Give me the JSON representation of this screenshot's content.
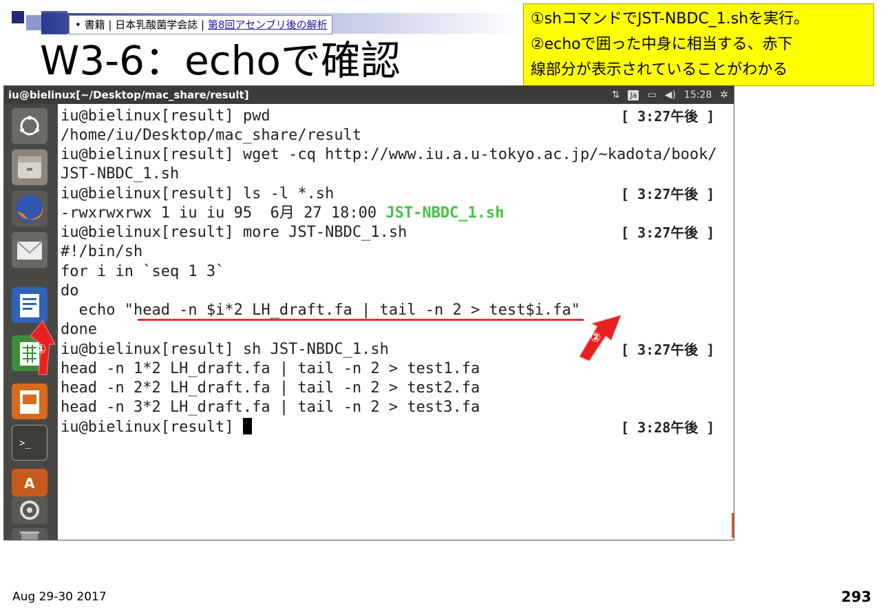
{
  "slide": {
    "reference": {
      "bullet": "•",
      "prefix": "書籍 | 日本乳酸菌学会誌 | ",
      "link": "第8回アセンブリ後の解析"
    },
    "title": "W3-6：echoで確認",
    "note_lines": [
      "①shコマンドでJST-NBDC_1.shを実行。",
      "②echoで囲った中身に相当する、赤下",
      "線部分が表示されていることがわかる"
    ],
    "footer_date": "Aug 29-30 2017",
    "page_number": "293"
  },
  "window": {
    "title": "iu@bielinux[~/Desktop/mac_share/result]",
    "ime": "Ja",
    "clock": "15:28",
    "indicator_icons": [
      "network-icon",
      "keyboard-icon",
      "battery-icon",
      "volume-icon",
      "settings-gear-icon"
    ]
  },
  "launcher": {
    "items": [
      "ubuntu-dash-icon",
      "files-icon",
      "firefox-icon",
      "mail-icon",
      "writer-icon",
      "calc-icon",
      "impress-icon",
      "terminal-icon",
      "software-center-icon",
      "system-settings-icon",
      "trash-icon"
    ]
  },
  "terminal": {
    "lines": [
      "iu@bielinux[result] pwd",
      "/home/iu/Desktop/mac_share/result",
      "iu@bielinux[result] wget -cq http://www.iu.a.u-tokyo.ac.jp/~kadota/book/",
      "JST-NBDC_1.sh",
      "iu@bielinux[result] ls -l *.sh",
      "-rwxrwxrwx 1 iu iu 95  6月 27 18:00 ",
      "iu@bielinux[result] more JST-NBDC_1.sh",
      "#!/bin/sh",
      "for i in `seq 1 3`",
      "do",
      "  echo \"head -n $i*2 LH_draft.fa | tail -n 2 > test$i.fa\"",
      "done",
      "iu@bielinux[result] sh JST-NBDC_1.sh",
      "head -n 1*2 LH_draft.fa | tail -n 2 > test1.fa",
      "head -n 2*2 LH_draft.fa | tail -n 2 > test2.fa",
      "head -n 3*2 LH_draft.fa | tail -n 2 > test3.fa",
      "iu@bielinux[result] "
    ],
    "ls_filename": "JST-NBDC_1.sh",
    "timestamps": {
      "pwd": "[ 3:27午後 ]",
      "ls": "[ 3:27午後 ]",
      "more": "[ 3:27午後 ]",
      "sh": "[ 3:27午後 ]",
      "prompt": "[ 3:28午後 ]"
    }
  },
  "annotations": {
    "marker1": "①",
    "marker2": "②",
    "arrow_color": "#e82020",
    "underline_color": "#e03030"
  }
}
